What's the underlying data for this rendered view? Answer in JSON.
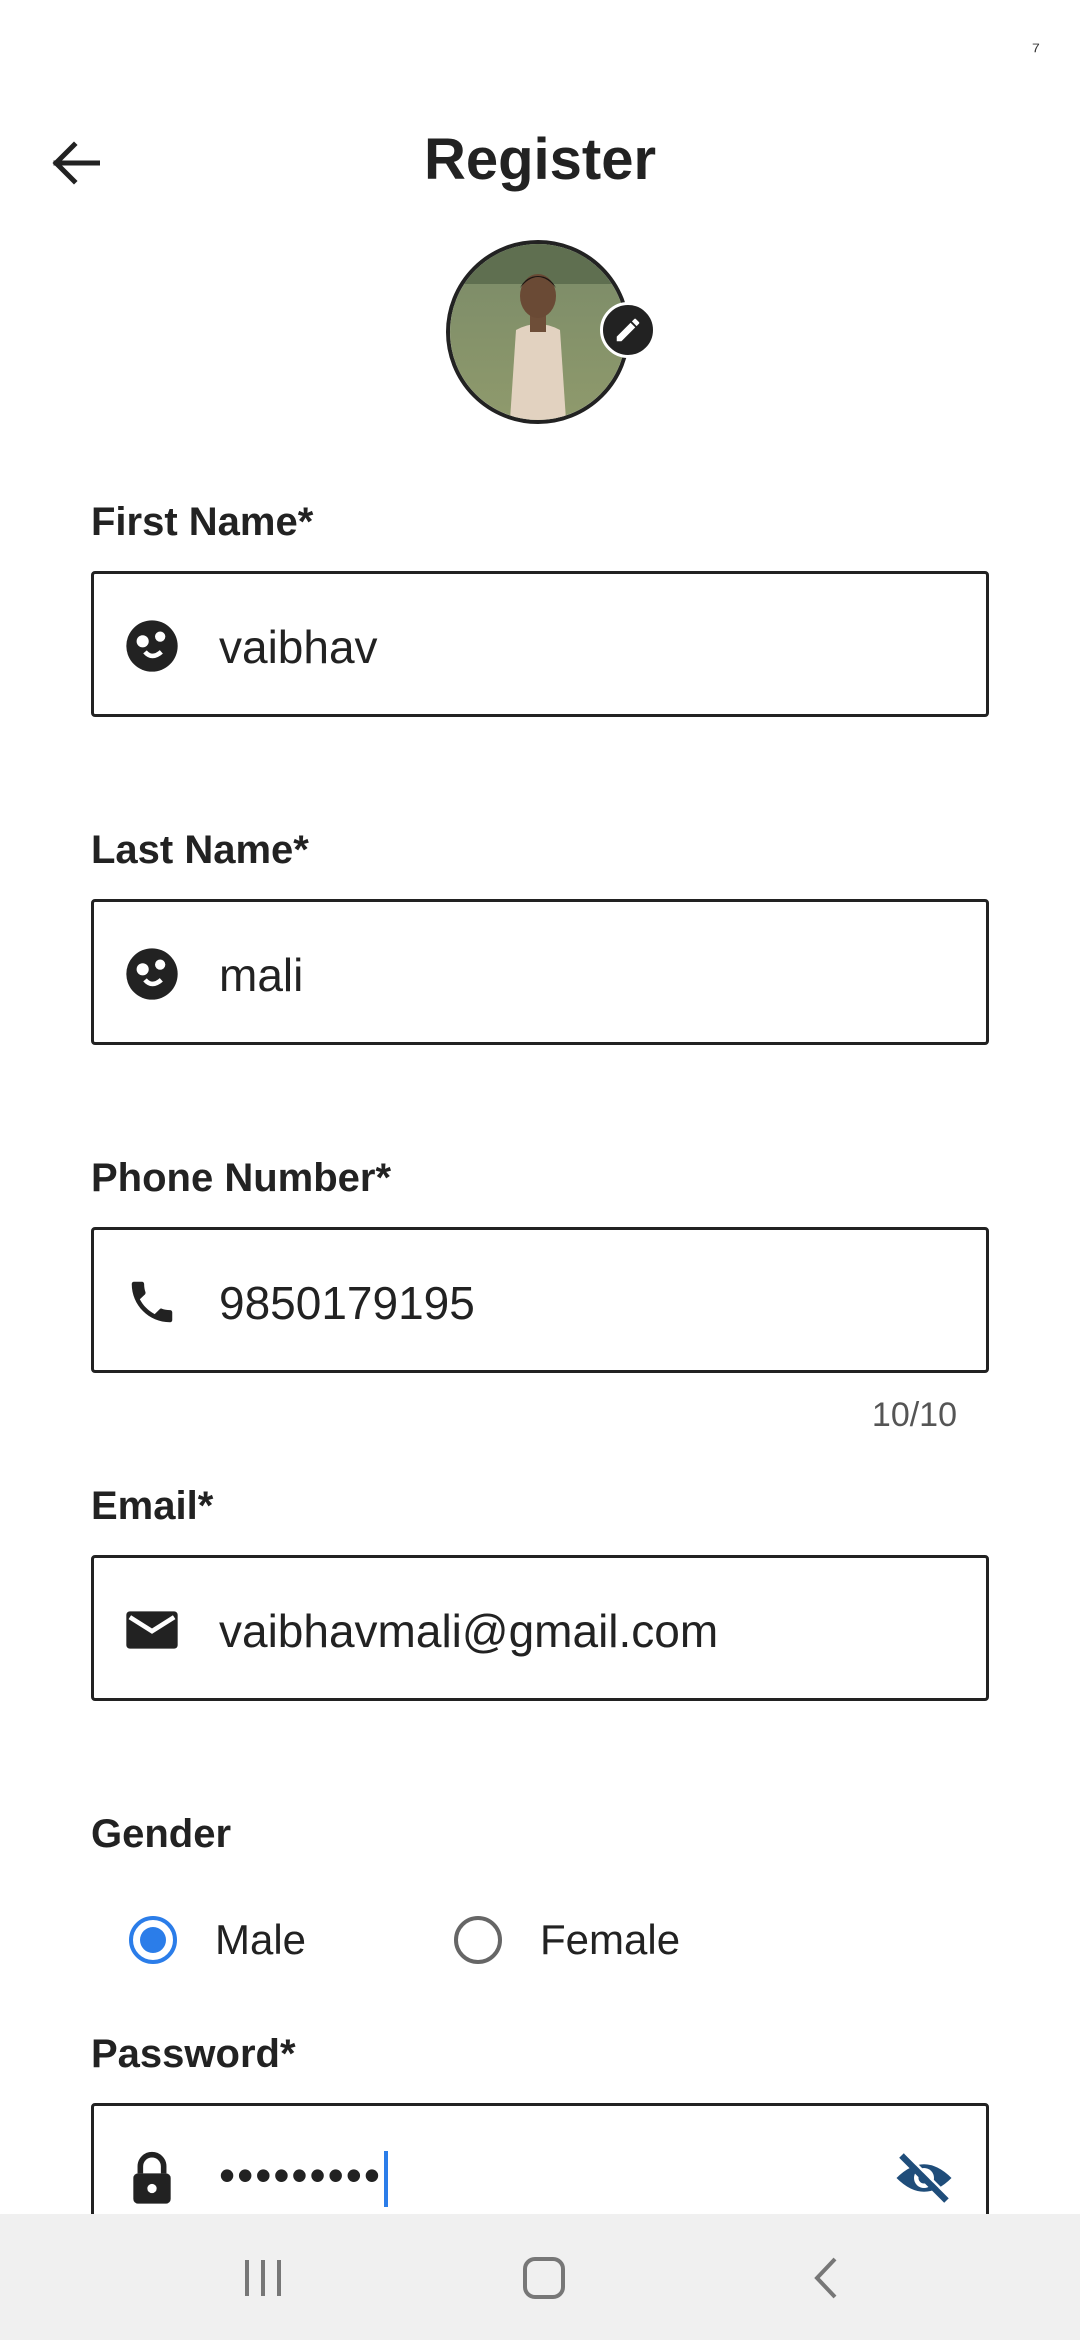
{
  "status": {
    "mark": "⁷"
  },
  "header": {
    "title": "Register",
    "back_icon": "arrow-left-icon"
  },
  "avatar": {
    "edit_icon": "pencil-icon"
  },
  "fields": {
    "first_name": {
      "label": "First Name*",
      "value": "vaibhav",
      "icon": "face-icon"
    },
    "last_name": {
      "label": "Last Name*",
      "value": "mali",
      "icon": "face-icon"
    },
    "phone": {
      "label": "Phone Number*",
      "value": "9850179195",
      "counter": "10/10",
      "icon": "phone-icon"
    },
    "email": {
      "label": "Email*",
      "value": "vaibhavmali@gmail.com",
      "icon": "mail-icon"
    },
    "password": {
      "label": "Password*",
      "value": "•••••••••",
      "icon": "lock-icon",
      "toggle_icon": "eye-off-icon"
    }
  },
  "gender": {
    "label": "Gender",
    "options": [
      {
        "label": "Male",
        "selected": true
      },
      {
        "label": "Female",
        "selected": false
      }
    ]
  },
  "colors": {
    "accent": "#2b7de9",
    "eye": "#1f4d7a"
  },
  "navbar": {
    "icons": [
      "recent-apps-icon",
      "home-icon",
      "back-icon"
    ]
  }
}
